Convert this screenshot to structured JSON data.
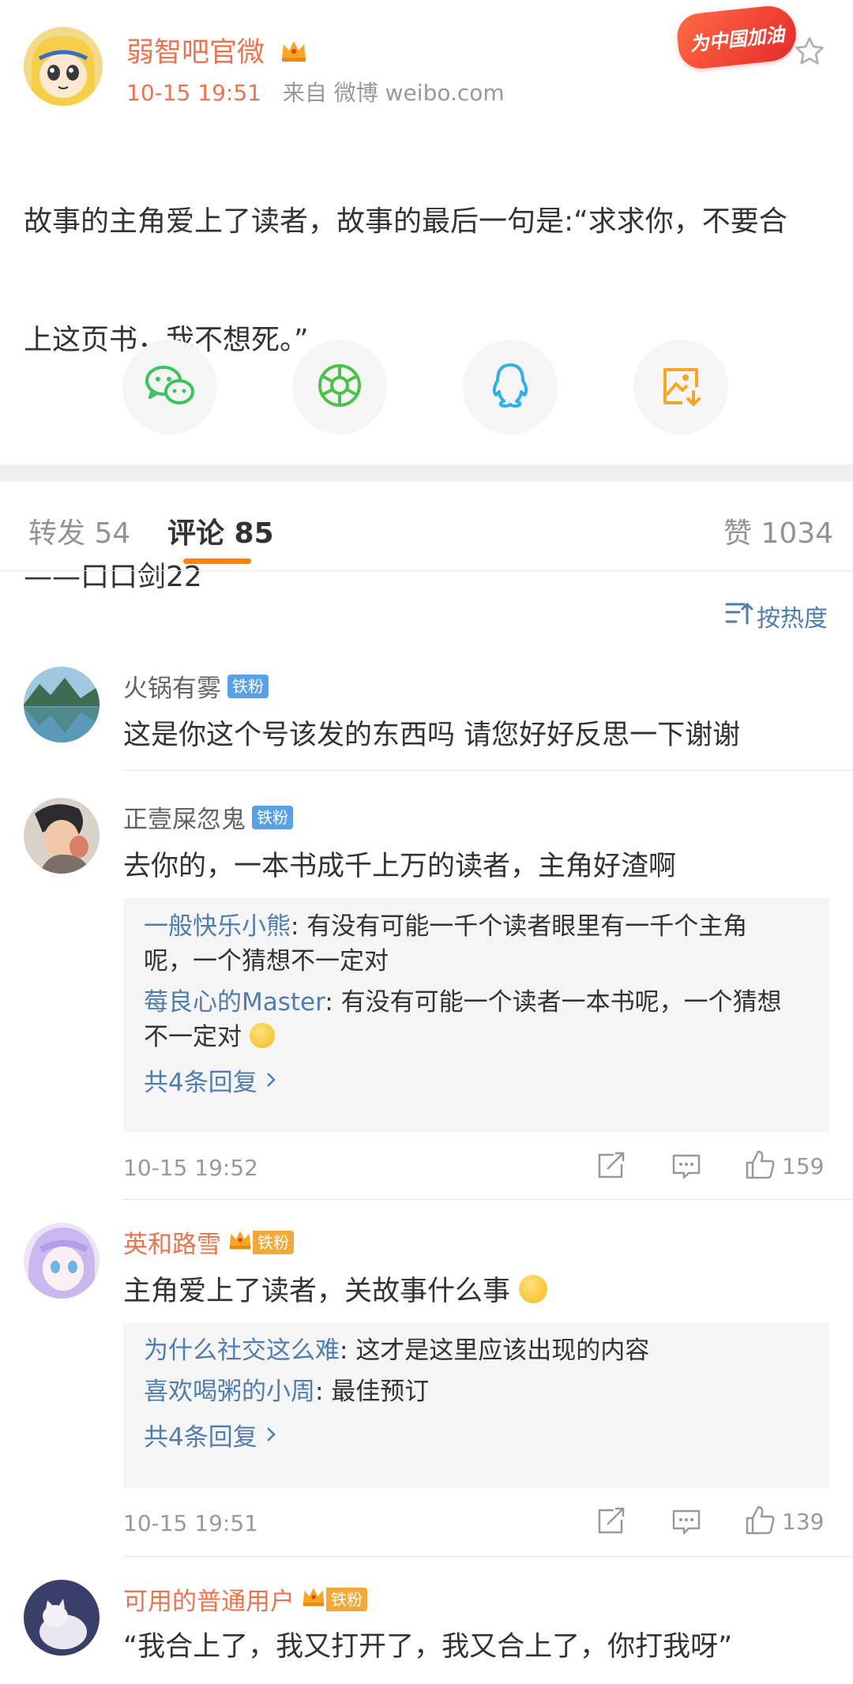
{
  "post": {
    "author": "弱智吧官微",
    "time": "10-15 19:51",
    "source": "来自 微博 weibo.com",
    "event_badge": "为中国加油",
    "body_line1": "故事的主角爱上了读者，故事的最后一句是:“求求你，不要合",
    "body_line2": "上这页书，我不想死。”",
    "body_line3": "——口口剑22"
  },
  "share": {
    "items": [
      {
        "icon": "wechat-icon"
      },
      {
        "icon": "moments-icon"
      },
      {
        "icon": "qq-icon"
      },
      {
        "icon": "save-image-icon"
      }
    ]
  },
  "tabs": {
    "repost": "转发 54",
    "comments": "评论 85",
    "likes": "赞 1034"
  },
  "sort": {
    "label": "按热度",
    "icon": "sort-icon"
  },
  "comments": [
    {
      "name": "火锅有雾",
      "badge": "铁粉",
      "text": "这是你这个号该发的东西吗 请您好好反思一下谢谢"
    },
    {
      "name": "正壹屎忽鬼",
      "badge": "铁粉",
      "text": "去你的，一本书成千上万的读者，主角好渣啊",
      "replies": [
        {
          "user": "一般快乐小熊",
          "text": ": 有没有可能一千个读者眼里有一千个主角",
          "text2": "呢，一个猜想不一定对"
        },
        {
          "user": "莓良心的Master",
          "text": ": 有没有可能一个读者一本书呢，一个猜想",
          "text2": "不一定对"
        }
      ],
      "more": "共4条回复",
      "time": "10-15 19:52",
      "likes": "159"
    },
    {
      "name": "英和路雪",
      "badge": "铁粉",
      "text": "主角爱上了读者，关故事什么事",
      "replies": [
        {
          "user": "为什么社交这么难",
          "text": ": 这才是这里应该出现的内容"
        },
        {
          "user": "喜欢喝粥的小周",
          "text": ": 最佳预订"
        }
      ],
      "more": "共4条回复",
      "time": "10-15 19:51",
      "likes": "139"
    },
    {
      "name": "可用的普通用户",
      "badge": "铁粉",
      "text": "“我合上了，我又打开了，我又合上了，你打我呀”"
    }
  ],
  "colors": {
    "accent": "#ff8200",
    "name_orange": "#eb7350",
    "link_blue": "#507daf",
    "badge_blue": "#5aa0e6"
  }
}
